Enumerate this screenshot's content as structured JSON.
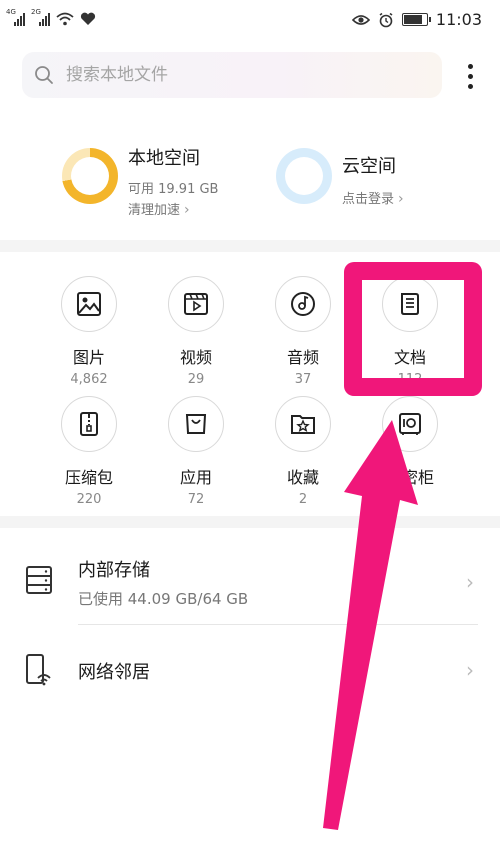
{
  "status_bar": {
    "network_1": "4G",
    "network_2": "2G",
    "time": "11:03",
    "battery_level": 0.9
  },
  "search": {
    "placeholder": "搜索本地文件",
    "icon": "search-icon"
  },
  "menu": {
    "icon": "more-vertical-icon"
  },
  "storage_summary": {
    "local": {
      "title": "本地空间",
      "available": "可用 19.91 GB",
      "action": "清理加速",
      "used_fraction": 0.72,
      "ring_color": "#f3b52b"
    },
    "cloud": {
      "title": "云空间",
      "action": "点击登录",
      "ring_color": "#d7ecfb"
    }
  },
  "categories": [
    {
      "name": "图片",
      "count": "4,862",
      "icon": "image-icon"
    },
    {
      "name": "视频",
      "count": "29",
      "icon": "video-icon"
    },
    {
      "name": "音频",
      "count": "37",
      "icon": "music-disc-icon"
    },
    {
      "name": "文档",
      "count": "112",
      "icon": "document-icon"
    },
    {
      "name": "压缩包",
      "count": "220",
      "icon": "zip-archive-icon"
    },
    {
      "name": "应用",
      "count": "72",
      "icon": "app-bag-icon"
    },
    {
      "name": "收藏",
      "count": "2",
      "icon": "favorites-folder-icon"
    },
    {
      "name": "保密柜",
      "count": "",
      "icon": "safe-icon"
    }
  ],
  "locations": [
    {
      "title": "内部存储",
      "subtitle": "已使用 44.09 GB/64 GB",
      "icon": "storage-icon"
    },
    {
      "title": "网络邻居",
      "subtitle": "",
      "icon": "network-neighbor-icon"
    }
  ],
  "annotation": {
    "highlight_color": "#f0177a"
  }
}
